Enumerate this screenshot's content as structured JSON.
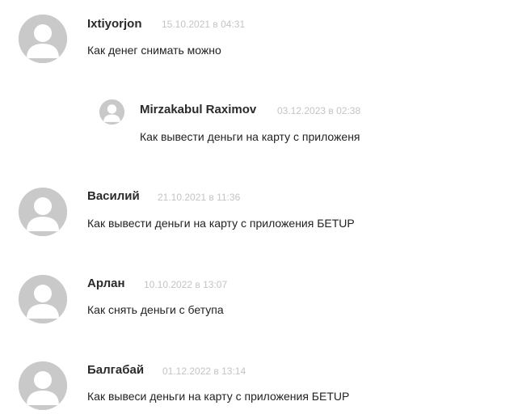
{
  "comments": [
    {
      "author": "Ixtiyorjon",
      "date": "15.10.2021 в 04:31",
      "text": "Как денег снимать можно",
      "reply": {
        "author": "Mirzakabul Raximov",
        "date": "03.12.2023 в 02:38",
        "text": "Как вывести деньги на карту с приложеня"
      }
    },
    {
      "author": "Василий",
      "date": "21.10.2021 в 11:36",
      "text": "Как вывести деньги на карту с приложения БЕТUP"
    },
    {
      "author": "Арлан",
      "date": "10.10.2022 в 13:07",
      "text": "Как снять деньги с бетупа"
    },
    {
      "author": "Балгабай",
      "date": "01.12.2022 в 13:14",
      "text": "Как вывеси деньги на карту с приложения БЕТUP"
    }
  ],
  "icons": {
    "avatar": "default-user-avatar-icon"
  }
}
